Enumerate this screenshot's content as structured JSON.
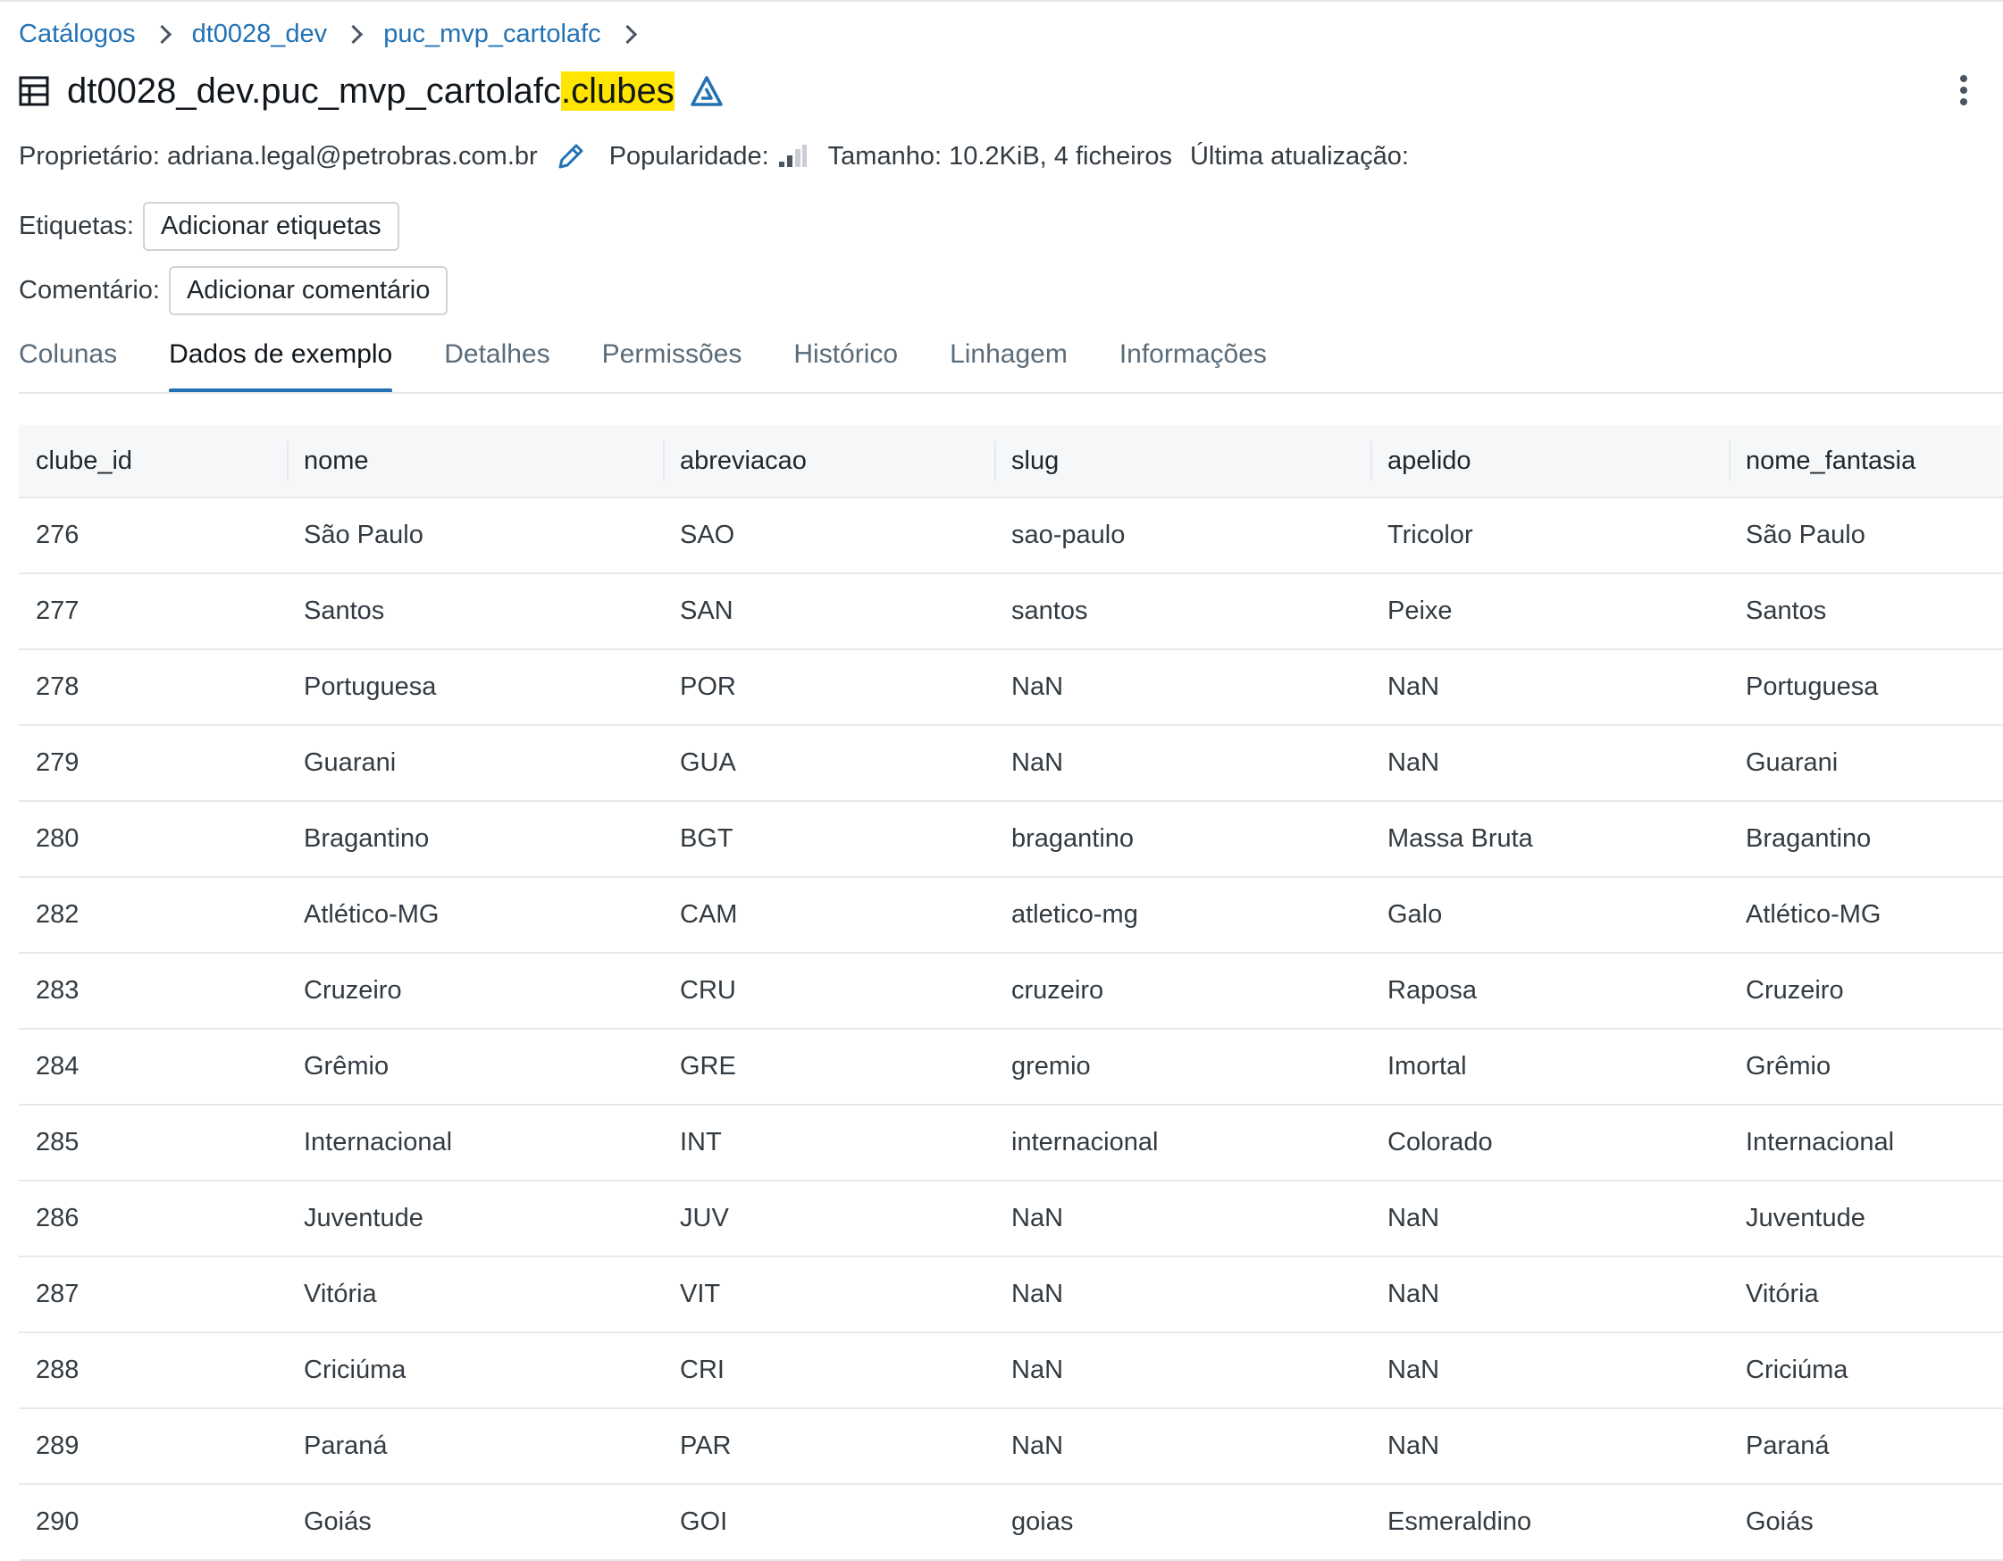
{
  "breadcrumb": [
    "Catálogos",
    "dt0028_dev",
    "puc_mvp_cartolafc"
  ],
  "title": {
    "prefix": "dt0028_dev.puc_mvp_cartolafc",
    "highlight": ".clubes"
  },
  "meta": {
    "owner_label": "Proprietário:",
    "owner": "adriana.legal@petrobras.com.br",
    "popularity_label": "Popularidade:",
    "size": "Tamanho: 10.2KiB, 4 ficheiros",
    "last_update_label": "Última atualização:"
  },
  "tags": {
    "label": "Etiquetas:",
    "button": "Adicionar etiquetas"
  },
  "comment": {
    "label": "Comentário:",
    "button": "Adicionar comentário"
  },
  "tabs": [
    "Colunas",
    "Dados de exemplo",
    "Detalhes",
    "Permissões",
    "Histórico",
    "Linhagem",
    "Informações"
  ],
  "active_tab": "Dados de exemplo",
  "table": {
    "columns": [
      "clube_id",
      "nome",
      "abreviacao",
      "slug",
      "apelido",
      "nome_fantasia"
    ],
    "rows": [
      [
        "276",
        "São Paulo",
        "SAO",
        "sao-paulo",
        "Tricolor",
        "São Paulo"
      ],
      [
        "277",
        "Santos",
        "SAN",
        "santos",
        "Peixe",
        "Santos"
      ],
      [
        "278",
        "Portuguesa",
        "POR",
        "NaN",
        "NaN",
        "Portuguesa"
      ],
      [
        "279",
        "Guarani",
        "GUA",
        "NaN",
        "NaN",
        "Guarani"
      ],
      [
        "280",
        "Bragantino",
        "BGT",
        "bragantino",
        "Massa Bruta",
        "Bragantino"
      ],
      [
        "282",
        "Atlético-MG",
        "CAM",
        "atletico-mg",
        "Galo",
        "Atlético-MG"
      ],
      [
        "283",
        "Cruzeiro",
        "CRU",
        "cruzeiro",
        "Raposa",
        "Cruzeiro"
      ],
      [
        "284",
        "Grêmio",
        "GRE",
        "gremio",
        "Imortal",
        "Grêmio"
      ],
      [
        "285",
        "Internacional",
        "INT",
        "internacional",
        "Colorado",
        "Internacional"
      ],
      [
        "286",
        "Juventude",
        "JUV",
        "NaN",
        "NaN",
        "Juventude"
      ],
      [
        "287",
        "Vitória",
        "VIT",
        "NaN",
        "NaN",
        "Vitória"
      ],
      [
        "288",
        "Criciúma",
        "CRI",
        "NaN",
        "NaN",
        "Criciúma"
      ],
      [
        "289",
        "Paraná",
        "PAR",
        "NaN",
        "NaN",
        "Paraná"
      ],
      [
        "290",
        "Goiás",
        "GOI",
        "goias",
        "Esmeraldino",
        "Goiás"
      ]
    ]
  },
  "colors": {
    "accent": "#2272b4",
    "highlight": "#ffe500"
  },
  "icons": [
    "chevron-right-icon",
    "table-icon",
    "delta-icon",
    "kebab-menu-icon",
    "pencil-icon",
    "popularity-bars-icon"
  ]
}
